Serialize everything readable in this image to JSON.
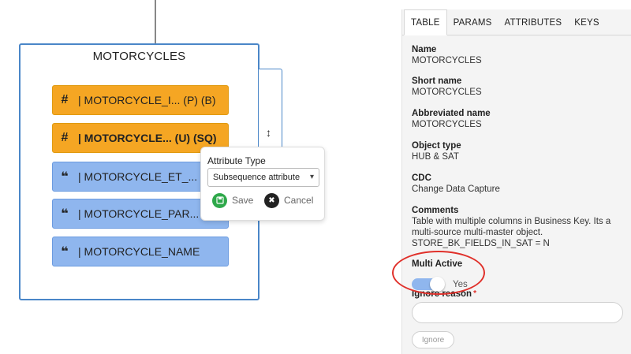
{
  "entity": {
    "title": "MOTORCYCLES",
    "attributes": [
      {
        "symbol": "#",
        "text": "| MOTORCYCLE_I... (P) (B)",
        "kind": "key",
        "color": "#f5a623"
      },
      {
        "symbol": "#",
        "text": "| MOTORCYCLE... (U) (SQ)",
        "kind": "key",
        "color": "#f5a623"
      },
      {
        "symbol": "❝",
        "text": "| MOTORCYCLE_ET_... (U",
        "kind": "attribute",
        "color": "#8fb6ee"
      },
      {
        "symbol": "❝",
        "text": "| MOTORCYCLE_PAR... (",
        "kind": "attribute",
        "color": "#8fb6ee"
      },
      {
        "symbol": "❝",
        "text": "| MOTORCYCLE_NAME",
        "kind": "attribute",
        "color": "#8fb6ee"
      }
    ],
    "resize_icon": "↕"
  },
  "popup": {
    "title": "Attribute Type",
    "selected_option": "Subsequence attribute",
    "save_label": "Save",
    "cancel_label": "Cancel",
    "save_icon": "save-icon",
    "cancel_icon": "close-icon"
  },
  "panel": {
    "tabs": [
      "TABLE",
      "PARAMS",
      "ATTRIBUTES",
      "KEYS"
    ],
    "active_tab": "TABLE",
    "fields": {
      "name": {
        "label": "Name",
        "value": "MOTORCYCLES"
      },
      "short_name": {
        "label": "Short name",
        "value": "MOTORCYCLES"
      },
      "abbreviated_name": {
        "label": "Abbreviated name",
        "value": "MOTORCYCLES"
      },
      "object_type": {
        "label": "Object type",
        "value": "HUB & SAT"
      },
      "cdc": {
        "label": "CDC",
        "value": "Change Data Capture"
      },
      "comments": {
        "label": "Comments",
        "value": "Table with multiple columns in Business Key. Its a multi-source multi-master object. STORE_BK_FIELDS_IN_SAT = N"
      }
    },
    "multi_active": {
      "label": "Multi Active",
      "toggle_text": "Yes",
      "enabled": true
    },
    "ignore_reason": {
      "label": "Ignore reason",
      "required_mark": "*",
      "value": ""
    },
    "ignore_button": "Ignore"
  },
  "colors": {
    "key_attr": "#f5a623",
    "attr": "#8fb6ee",
    "border": "#4a86c8",
    "highlight": "#e0302a",
    "save": "#2ea84a"
  }
}
